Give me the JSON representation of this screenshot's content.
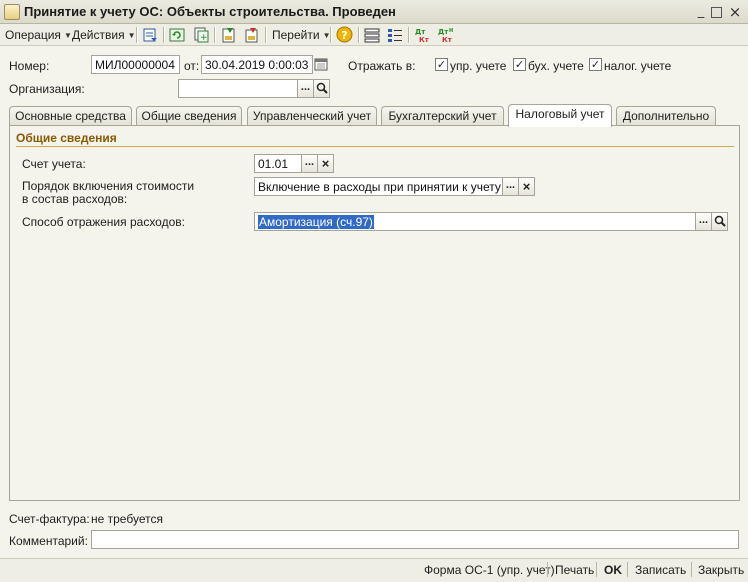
{
  "window": {
    "title": "Принятие к учету ОС: Объекты строительства. Проведен",
    "minimize": "_",
    "maximize": "□",
    "close": "×"
  },
  "toolbar": {
    "operation_label": "Операция",
    "actions_label": "Действия",
    "goto_label": "Перейти",
    "icons": [
      "post-document-icon",
      "refresh-icon",
      "copy-icon",
      "fill-icon",
      "attach-icon",
      "help-icon",
      "structure-icon",
      "list-settings-icon",
      "dt-kt-icon",
      "dt-kt-n-icon"
    ]
  },
  "header": {
    "number_label": "Номер:",
    "number_value": "МИЛ00000004",
    "date_label": "от:",
    "date_value": "30.04.2019  0:00:03",
    "reflect_label": "Отражать в:",
    "checkboxes": [
      {
        "label": "упр. учете",
        "checked": true
      },
      {
        "label": "бух. учете",
        "checked": true
      },
      {
        "label": "налог. учете",
        "checked": true
      }
    ],
    "organization_label": "Организация:",
    "organization_value": ""
  },
  "tabs": [
    {
      "label": "Основные средства",
      "active": false
    },
    {
      "label": "Общие сведения",
      "active": false
    },
    {
      "label": "Управленческий учет",
      "active": false
    },
    {
      "label": "Бухгалтерский учет",
      "active": false
    },
    {
      "label": "Налоговый учет",
      "active": true
    },
    {
      "label": "Дополнительно",
      "active": false
    }
  ],
  "panel": {
    "section_title": "Общие сведения",
    "account_label": "Счет учета:",
    "account_value": "01.01",
    "cost_order_label_1": "Порядок включения стоимости",
    "cost_order_label_2": "в состав расходов:",
    "cost_order_value": "Включение в расходы при принятии к учету",
    "expense_method_label": "Способ отражения расходов:",
    "expense_method_value": "Амортизация (сч.97)"
  },
  "bottom": {
    "invoice_label": "Счет-фактура:",
    "invoice_value": "не требуется",
    "comment_label": "Комментарий:",
    "comment_value": ""
  },
  "footer": {
    "form_os1": "Форма ОС-1 (упр. учет)",
    "print": "Печать",
    "ok": "OK",
    "save": "Записать",
    "close": "Закрыть"
  },
  "colors": {
    "accent_section": "#8a5a00",
    "selection": "#316ac5",
    "window_bg": "#f4f3ec"
  }
}
